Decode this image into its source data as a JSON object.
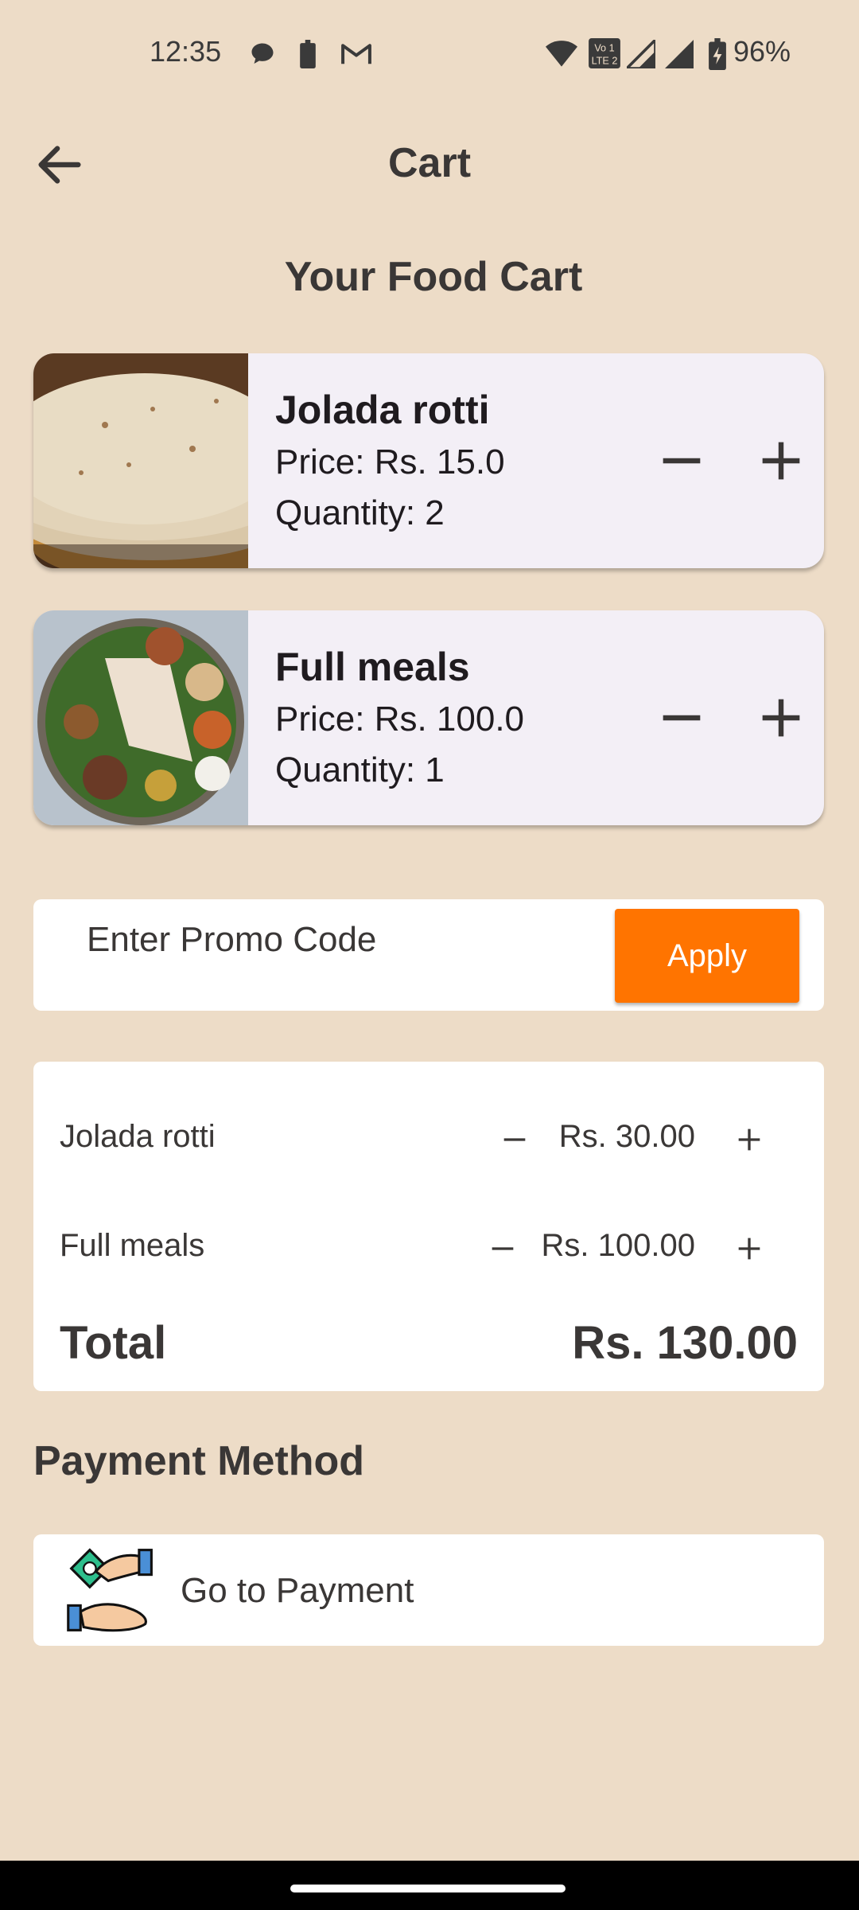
{
  "status_bar": {
    "time": "12:35",
    "battery_pct": "96%",
    "left_icons": [
      "chat-bubble-icon",
      "battery-small-icon",
      "gmail-icon"
    ],
    "right_icons": [
      "wifi-icon",
      "volte-icon",
      "signal-icon",
      "signal-icon",
      "battery-charging-icon"
    ]
  },
  "app_bar": {
    "title": "Cart",
    "back_icon": "arrow-back-icon"
  },
  "section_title": "Your Food Cart",
  "cart_items": [
    {
      "name": "Jolada rotti",
      "price": "Price: Rs. 15.0",
      "quantity": "Quantity: 2",
      "image": "jolada-rotti-photo"
    },
    {
      "name": "Full meals",
      "price": "Price: Rs. 100.0",
      "quantity": "Quantity: 1",
      "image": "full-meals-photo"
    }
  ],
  "promo": {
    "placeholder": "Enter Promo Code",
    "apply_label": "Apply"
  },
  "summary": {
    "rows": [
      {
        "name": "Jolada rotti",
        "amount": "Rs. 30.00"
      },
      {
        "name": "Full meals",
        "amount": "Rs. 100.00"
      }
    ],
    "total_label": "Total",
    "total_amount": "Rs. 130.00"
  },
  "payment": {
    "title": "Payment Method",
    "button_label": "Go to Payment",
    "icon": "cash-hands-icon"
  },
  "colors": {
    "background": "#EDDCC7",
    "card": "#F3EFF6",
    "accent": "#FF7400",
    "text": "#3A3736"
  }
}
